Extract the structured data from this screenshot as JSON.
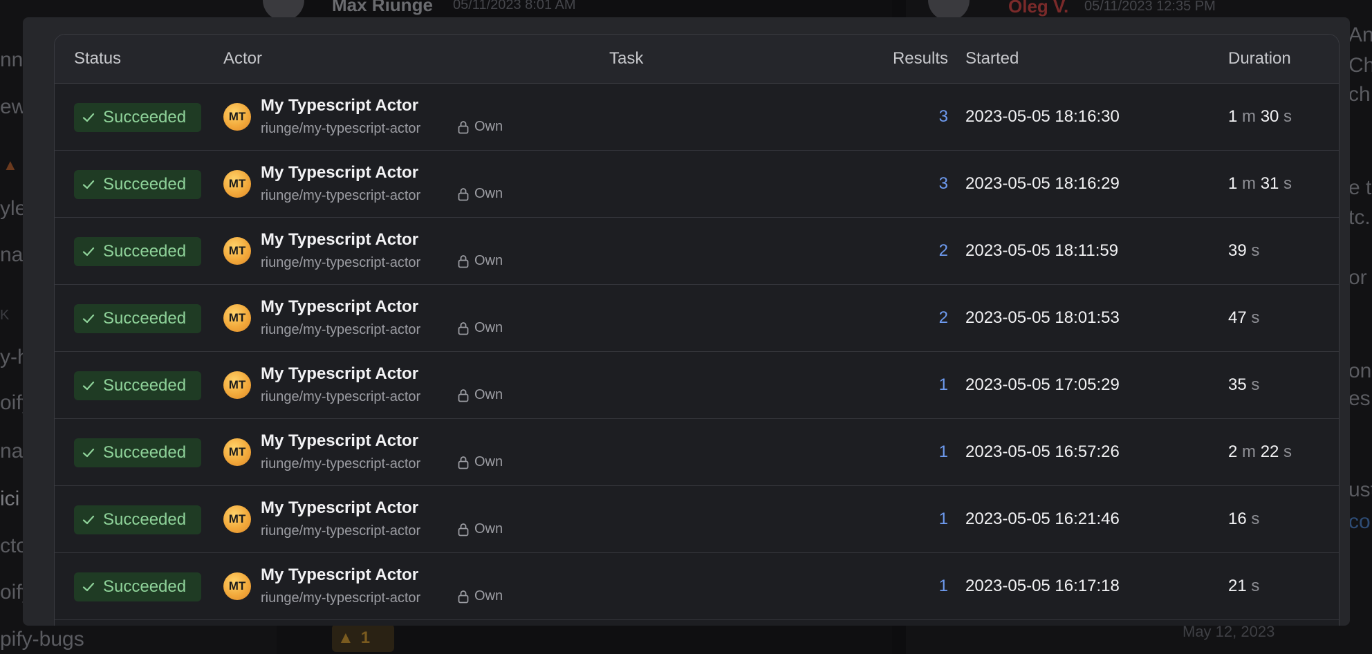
{
  "background": {
    "left_fragments": [
      "nn",
      "ew",
      "yle",
      "nat",
      "K",
      "y-h",
      "oify",
      "nat",
      "ici",
      "cto",
      "oify",
      "pify-bugs"
    ],
    "mid_author": "Max Riunge",
    "mid_time": "05/11/2023 8:01 AM",
    "right_author": "Oleg V.",
    "right_time": "05/11/2023 12:35 PM",
    "right_fragments": [
      "An",
      "Chr",
      "ch",
      "e t",
      "tc.",
      "or",
      "on",
      "es",
      "ust",
      "co"
    ],
    "reaction_count": "1",
    "date_divider": "May 12, 2023"
  },
  "table": {
    "headers": {
      "status": "Status",
      "actor": "Actor",
      "task": "Task",
      "results": "Results",
      "started": "Started",
      "duration": "Duration"
    },
    "rows": [
      {
        "status": "Succeeded",
        "avatar": "MT",
        "actor_name": "My Typescript Actor",
        "actor_slug": "riunge/my-typescript-actor",
        "ownership": "Own",
        "results": "3",
        "started": "2023-05-05 18:16:30",
        "duration": [
          {
            "n": "1",
            "u": "m"
          },
          {
            "n": "30",
            "u": "s"
          }
        ]
      },
      {
        "status": "Succeeded",
        "avatar": "MT",
        "actor_name": "My Typescript Actor",
        "actor_slug": "riunge/my-typescript-actor",
        "ownership": "Own",
        "results": "3",
        "started": "2023-05-05 18:16:29",
        "duration": [
          {
            "n": "1",
            "u": "m"
          },
          {
            "n": "31",
            "u": "s"
          }
        ]
      },
      {
        "status": "Succeeded",
        "avatar": "MT",
        "actor_name": "My Typescript Actor",
        "actor_slug": "riunge/my-typescript-actor",
        "ownership": "Own",
        "results": "2",
        "started": "2023-05-05 18:11:59",
        "duration": [
          {
            "n": "39",
            "u": "s"
          }
        ]
      },
      {
        "status": "Succeeded",
        "avatar": "MT",
        "actor_name": "My Typescript Actor",
        "actor_slug": "riunge/my-typescript-actor",
        "ownership": "Own",
        "results": "2",
        "started": "2023-05-05 18:01:53",
        "duration": [
          {
            "n": "47",
            "u": "s"
          }
        ]
      },
      {
        "status": "Succeeded",
        "avatar": "MT",
        "actor_name": "My Typescript Actor",
        "actor_slug": "riunge/my-typescript-actor",
        "ownership": "Own",
        "results": "1",
        "started": "2023-05-05 17:05:29",
        "duration": [
          {
            "n": "35",
            "u": "s"
          }
        ]
      },
      {
        "status": "Succeeded",
        "avatar": "MT",
        "actor_name": "My Typescript Actor",
        "actor_slug": "riunge/my-typescript-actor",
        "ownership": "Own",
        "results": "1",
        "started": "2023-05-05 16:57:26",
        "duration": [
          {
            "n": "2",
            "u": "m"
          },
          {
            "n": "22",
            "u": "s"
          }
        ]
      },
      {
        "status": "Succeeded",
        "avatar": "MT",
        "actor_name": "My Typescript Actor",
        "actor_slug": "riunge/my-typescript-actor",
        "ownership": "Own",
        "results": "1",
        "started": "2023-05-05 16:21:46",
        "duration": [
          {
            "n": "16",
            "u": "s"
          }
        ]
      },
      {
        "status": "Succeeded",
        "avatar": "MT",
        "actor_name": "My Typescript Actor",
        "actor_slug": "riunge/my-typescript-actor",
        "ownership": "Own",
        "results": "1",
        "started": "2023-05-05 16:17:18",
        "duration": [
          {
            "n": "21",
            "u": "s"
          }
        ]
      }
    ]
  },
  "colors": {
    "status_success_bg": "#1f3b24",
    "status_success_text": "#8fd39a",
    "results_link": "#6e9bf0",
    "avatar_gradient": "#f2a93b"
  }
}
